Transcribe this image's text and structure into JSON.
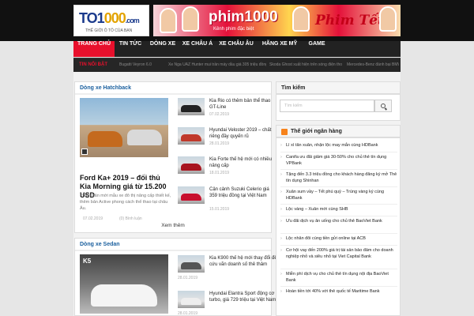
{
  "logo": {
    "brand_main": "TO1",
    "brand_zero": "000",
    "brand_tail": ".com",
    "tagline": "THẾ GIỚI Ô TÔ CỦA BẠN"
  },
  "banner": {
    "title": "phim1000",
    "subtitle": "Kênh phim đặc biệt",
    "badge": "Phim Tết"
  },
  "nav": {
    "items": [
      "TRANG CHỦ",
      "TIN TỨC",
      "DÒNG XE",
      "XE CHÂU Á",
      "XE CHÂU ÂU",
      "HÃNG XE MỸ",
      "GAME"
    ]
  },
  "ticker": {
    "label": "TIN NỔI BẬT",
    "items": [
      "Bugatti Veyron 6.0",
      "Xe Nga UAZ Hunter mui trần máy dầu giá 305 triệu đồng",
      "Skoda Ghost xuất hiện trên sóng điện thoại mới 0.6l",
      "Mercedes-Benz đánh bại BMW"
    ]
  },
  "hatchback": {
    "heading": "Dòng xe Hatchback",
    "featured": {
      "title": "Ford Ka+ 2019 – đối thủ Kia Morning giá từ 15.200 USD",
      "desc": "Phiên bản mới mẫu xe đô thị nâng cấp thiết kế, thêm bản Active phong cách thể thao tại châu Âu.",
      "date": "07.02.2019",
      "comments": "(0) Bình luận"
    },
    "items": [
      {
        "title": "Kia Rio có thêm bản thể thao GT-Line",
        "date": "07.02.2019"
      },
      {
        "title": "Hyundai Veloster 2019 – chất riêng đầy quyến rũ",
        "date": "28.01.2019"
      },
      {
        "title": "Kia Forte thế hệ mới có nhiều nâng cấp",
        "date": "18.01.2019"
      },
      {
        "title": "Cận cảnh Suzuki Celerio giá 359 triệu đồng tại Việt Nam",
        "date": "15.01.2019"
      }
    ],
    "more": "Xem thêm"
  },
  "sedan": {
    "heading": "Dòng xe Sedan",
    "items": [
      {
        "title": "Kia K900 thế hệ mới thay đổi để cứu vãn doanh số thê thảm",
        "date": "28.01.2019"
      },
      {
        "title": "Hyundai Elantra Sport động cơ turbo, giá 729 triệu tại Việt Nam",
        "date": "28.01.2019"
      }
    ]
  },
  "search": {
    "heading": "Tìm kiếm",
    "placeholder": "Tìm kiếm"
  },
  "bank": {
    "heading": "Thế giới ngân hàng",
    "items": [
      "Lì xì tân xuân, nhận lộc may mắn cùng HDBank",
      "Canifa ưu đãi giảm giá 30-50% cho chủ thẻ tín dụng VPBank",
      "Tặng đến 3.3 triệu đồng cho khách hàng đăng ký mở Thẻ tín dụng Shinhan",
      "Xuân sum vầy – Tết phú quý – Trúng vàng ký cùng HDBank",
      "Lộc vàng – Xuân mới cùng SHB",
      "Ưu đãi dịch vụ ăn uống cho chủ thẻ BaoViet Bank",
      "Lộc nhân đôi cùng tiền gửi online tại ACB",
      "Cơ hội vay đến 200% giá trị tài sản bảo đảm cho doanh nghiệp nhỏ và siêu nhỏ tại Viet Capital Bank",
      "Miễn phí dịch vụ cho chủ thẻ tín dụng nội địa BaoViet Bank",
      "Hoàn tiền tới 40% với thẻ quốc tế Maritime Bank"
    ]
  },
  "colors": {
    "accent": "#e8102c",
    "link": "#1a5f9e",
    "nav_bg": "#222222"
  }
}
